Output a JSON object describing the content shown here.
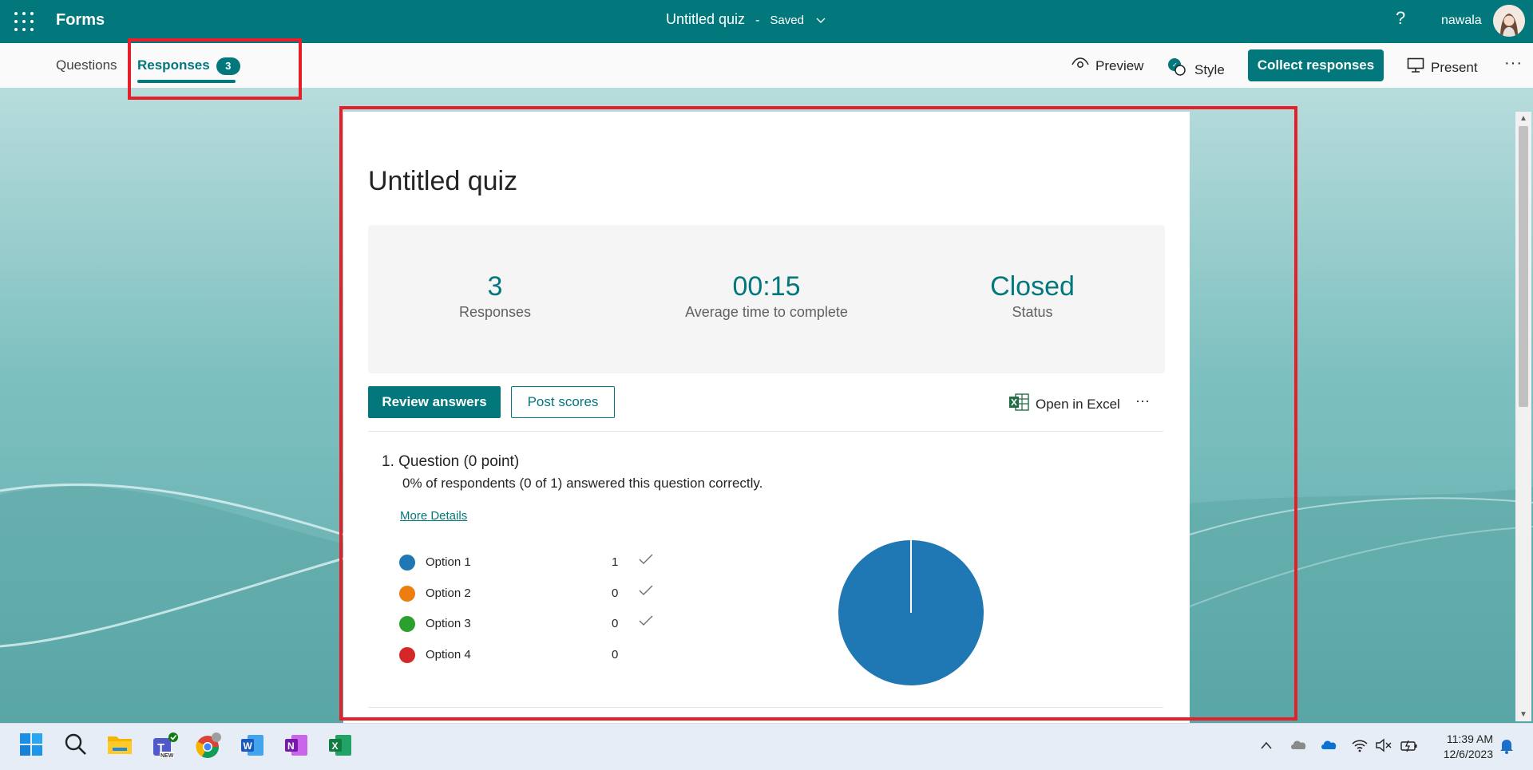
{
  "header": {
    "app_name": "Forms",
    "doc_title": "Untitled quiz",
    "separator": "-",
    "save_status": "Saved",
    "help_label": "?",
    "user_name": "nawala"
  },
  "subbar": {
    "tabs": [
      {
        "label": "Questions"
      },
      {
        "label": "Responses",
        "badge": "3"
      }
    ],
    "preview_label": "Preview",
    "style_label": "Style",
    "collect_label": "Collect responses",
    "present_label": "Present",
    "more_label": "···"
  },
  "quiz": {
    "title": "Untitled quiz",
    "stats": [
      {
        "value": "3",
        "label": "Responses"
      },
      {
        "value": "00:15",
        "label": "Average time to complete"
      },
      {
        "value": "Closed",
        "label": "Status"
      }
    ],
    "review_label": "Review answers",
    "post_label": "Post scores",
    "excel_label": "Open in Excel",
    "more_label": "···"
  },
  "question": {
    "number": "1.",
    "title": "Question (0 point)",
    "summary": "0% of respondents (0 of 1) answered this question correctly.",
    "more_details": "More Details",
    "options": [
      {
        "name": "Option 1",
        "count": "1",
        "correct": true,
        "color": "#1f77b4"
      },
      {
        "name": "Option 2",
        "count": "0",
        "correct": true,
        "color": "#ed7d0e"
      },
      {
        "name": "Option 3",
        "count": "0",
        "correct": true,
        "color": "#2ca02c"
      },
      {
        "name": "Option 4",
        "count": "0",
        "correct": false,
        "color": "#d62728"
      }
    ]
  },
  "chart_data": {
    "type": "pie",
    "categories": [
      "Option 1",
      "Option 2",
      "Option 3",
      "Option 4"
    ],
    "values": [
      1,
      0,
      0,
      0
    ],
    "colors": [
      "#1f77b4",
      "#ed7d0e",
      "#2ca02c",
      "#d62728"
    ]
  },
  "taskbar": {
    "time": "11:39 AM",
    "date": "12/6/2023"
  },
  "colors": {
    "brand": "#03787c",
    "highlight": "#e5202a"
  }
}
